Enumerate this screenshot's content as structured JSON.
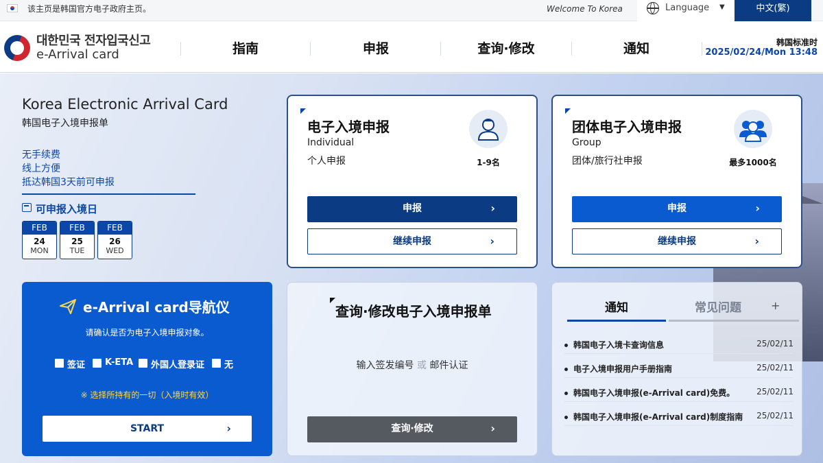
{
  "topbar": {
    "notice": "该主页是韩国官方电子政府主页。",
    "welcome": "Welcome To Korea",
    "language_label": "Language",
    "current_language": "中文(繁)"
  },
  "header": {
    "logo_kr": "대한민국 전자입국신고",
    "logo_en": "e-Arrival card",
    "nav": [
      "指南",
      "申报",
      "查询·修改",
      "通知"
    ],
    "time_label": "韩国标准时",
    "time_value": "2025/02/24/Mon 13:48"
  },
  "intro": {
    "title": "Korea Electronic Arrival Card",
    "subtitle": "韩国电子入境申报单",
    "features": [
      "无手续费",
      "线上方便",
      "抵达韩国3天前可申报"
    ],
    "dates_label": "可申报入境日",
    "dates": [
      {
        "month": "FEB",
        "day": "24",
        "weekday": "MON"
      },
      {
        "month": "FEB",
        "day": "25",
        "weekday": "TUE"
      },
      {
        "month": "FEB",
        "day": "26",
        "weekday": "WED"
      }
    ]
  },
  "individual": {
    "title": "电子入境申报",
    "en": "Individual",
    "cn": "个人申报",
    "count": "1-9名",
    "submit": "申报",
    "continue": "继续申报"
  },
  "group": {
    "title": "团体电子入境申报",
    "en": "Group",
    "cn": "团体/旅行社申报",
    "count": "最多1000名",
    "submit": "申报",
    "continue": "继续申报"
  },
  "navigator": {
    "title": "e-Arrival card导航仪",
    "desc": "请确认是否为电子入境申报对象。",
    "options": [
      "签证",
      "K-ETA",
      "外国人登录证",
      "无"
    ],
    "hint": "※ 选择所持有的一切（入境时有效）",
    "start": "START"
  },
  "query": {
    "title": "查询·修改电子入境申报单",
    "text_a": "输入签发编号",
    "text_or": "或",
    "text_b": "邮件认证",
    "button": "查询·修改"
  },
  "notices": {
    "tab_active": "通知",
    "tab_inactive": "常见问题",
    "plus": "+",
    "items": [
      {
        "title": "韩国电子入境卡查询信息",
        "date": "25/02/11"
      },
      {
        "title": "电子入境申报用户手册指南",
        "date": "25/02/11"
      },
      {
        "title": "韩国电子入境申报(e-Arrival card)免费。",
        "date": "25/02/11"
      },
      {
        "title": "韩国电子入境申报(e-Arrival card)制度指南",
        "date": "25/02/11"
      }
    ]
  },
  "colors": {
    "primary_dark": "#0b3c83",
    "primary": "#0b5bd0",
    "accent_yellow": "#ffd84a",
    "gray_button": "#555a60"
  }
}
